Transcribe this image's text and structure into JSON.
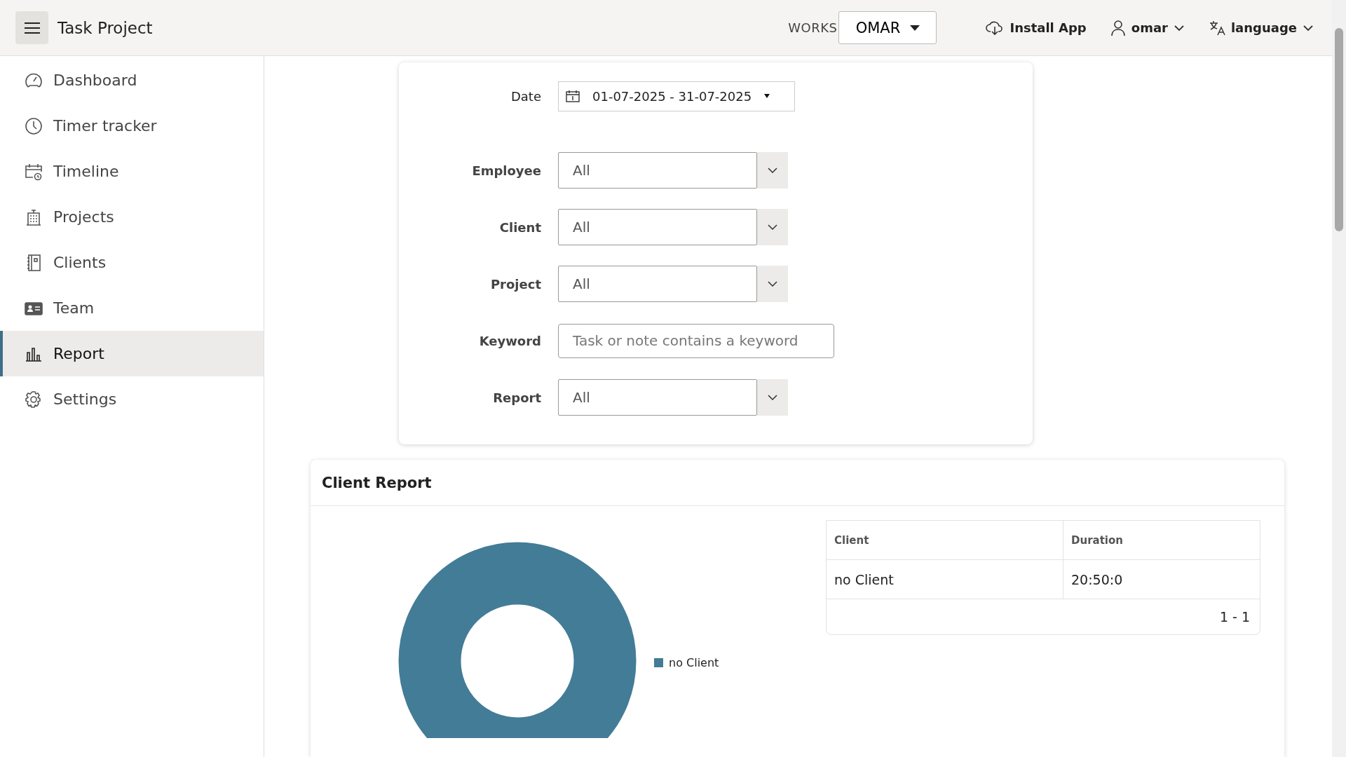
{
  "header": {
    "title": "Task Project",
    "workspace_label": "WORKS",
    "workspace": "OMAR",
    "install": "Install App",
    "user": "omar",
    "language": "language"
  },
  "sidebar": {
    "items": [
      {
        "label": "Dashboard",
        "selected": false
      },
      {
        "label": "Timer tracker",
        "selected": false
      },
      {
        "label": "Timeline",
        "selected": false
      },
      {
        "label": "Projects",
        "selected": false
      },
      {
        "label": "Clients",
        "selected": false
      },
      {
        "label": "Team",
        "selected": false
      },
      {
        "label": "Report",
        "selected": true
      },
      {
        "label": "Settings",
        "selected": false
      }
    ]
  },
  "filters": {
    "date": {
      "label": "Date",
      "value": "01-07-2025 - 31-07-2025"
    },
    "fields": [
      {
        "kind": "select",
        "label": "Employee",
        "value": "All"
      },
      {
        "kind": "select",
        "label": "Client",
        "value": "All"
      },
      {
        "kind": "select",
        "label": "Project",
        "value": "All"
      },
      {
        "kind": "text",
        "label": "Keyword",
        "placeholder": "Task or note contains a keyword"
      },
      {
        "kind": "select",
        "label": "Report",
        "value": "All"
      }
    ]
  },
  "client_report": {
    "title": "Client Report",
    "legend": [
      {
        "label": "no Client",
        "color": "#437c96"
      }
    ],
    "table": {
      "columns": [
        "Client",
        "Duration"
      ],
      "rows": [
        [
          "no Client",
          "20:50:0"
        ]
      ],
      "pagination": "1 - 1"
    }
  }
}
